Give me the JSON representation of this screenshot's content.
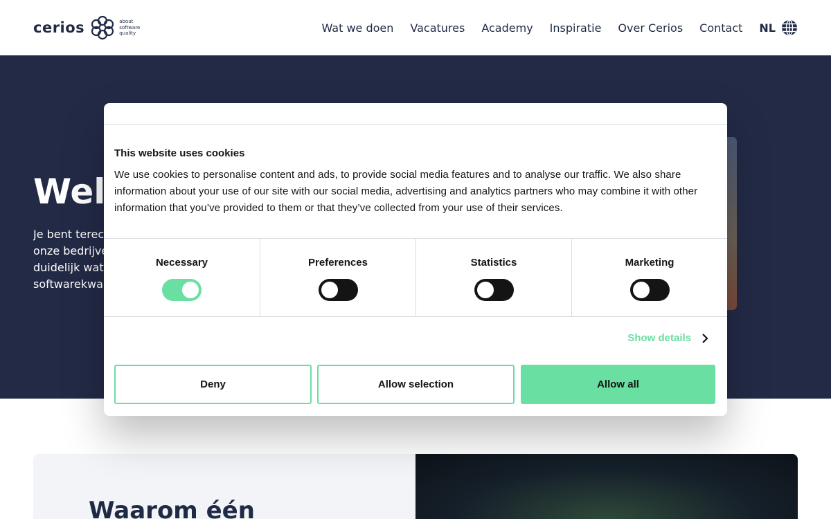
{
  "header": {
    "logo_word": "cerios",
    "logo_tagline": [
      "about",
      "software",
      "quality"
    ],
    "nav": [
      "Wat we doen",
      "Vacatures",
      "Academy",
      "Inspiratie",
      "Over Cerios",
      "Contact"
    ],
    "language": "NL",
    "globe_icon": "globe-icon"
  },
  "hero": {
    "title": "Welk",
    "text_lines": [
      "Je bent terech",
      "onze bedrijve",
      "duidelijk wat",
      "softwarekwal"
    ]
  },
  "section": {
    "title": "Waarom één"
  },
  "cookie_dialog": {
    "title": "This website uses cookies",
    "body": "We use cookies to personalise content and ads, to provide social media features and to analyse our traffic. We also share information about your use of our site with our social media, advertising and analytics partners who may combine it with other information that you’ve provided to them or that they’ve collected from your use of their services.",
    "toggles": [
      {
        "label": "Necessary",
        "on": true
      },
      {
        "label": "Preferences",
        "on": false
      },
      {
        "label": "Statistics",
        "on": false
      },
      {
        "label": "Marketing",
        "on": false
      }
    ],
    "show_details": "Show details",
    "buttons": {
      "deny": "Deny",
      "allow_selection": "Allow selection",
      "allow_all": "Allow all"
    },
    "accent_color": "#69dfa1"
  },
  "colors": {
    "hero_bg": "#232a46",
    "text_dark": "#1f2a44"
  }
}
